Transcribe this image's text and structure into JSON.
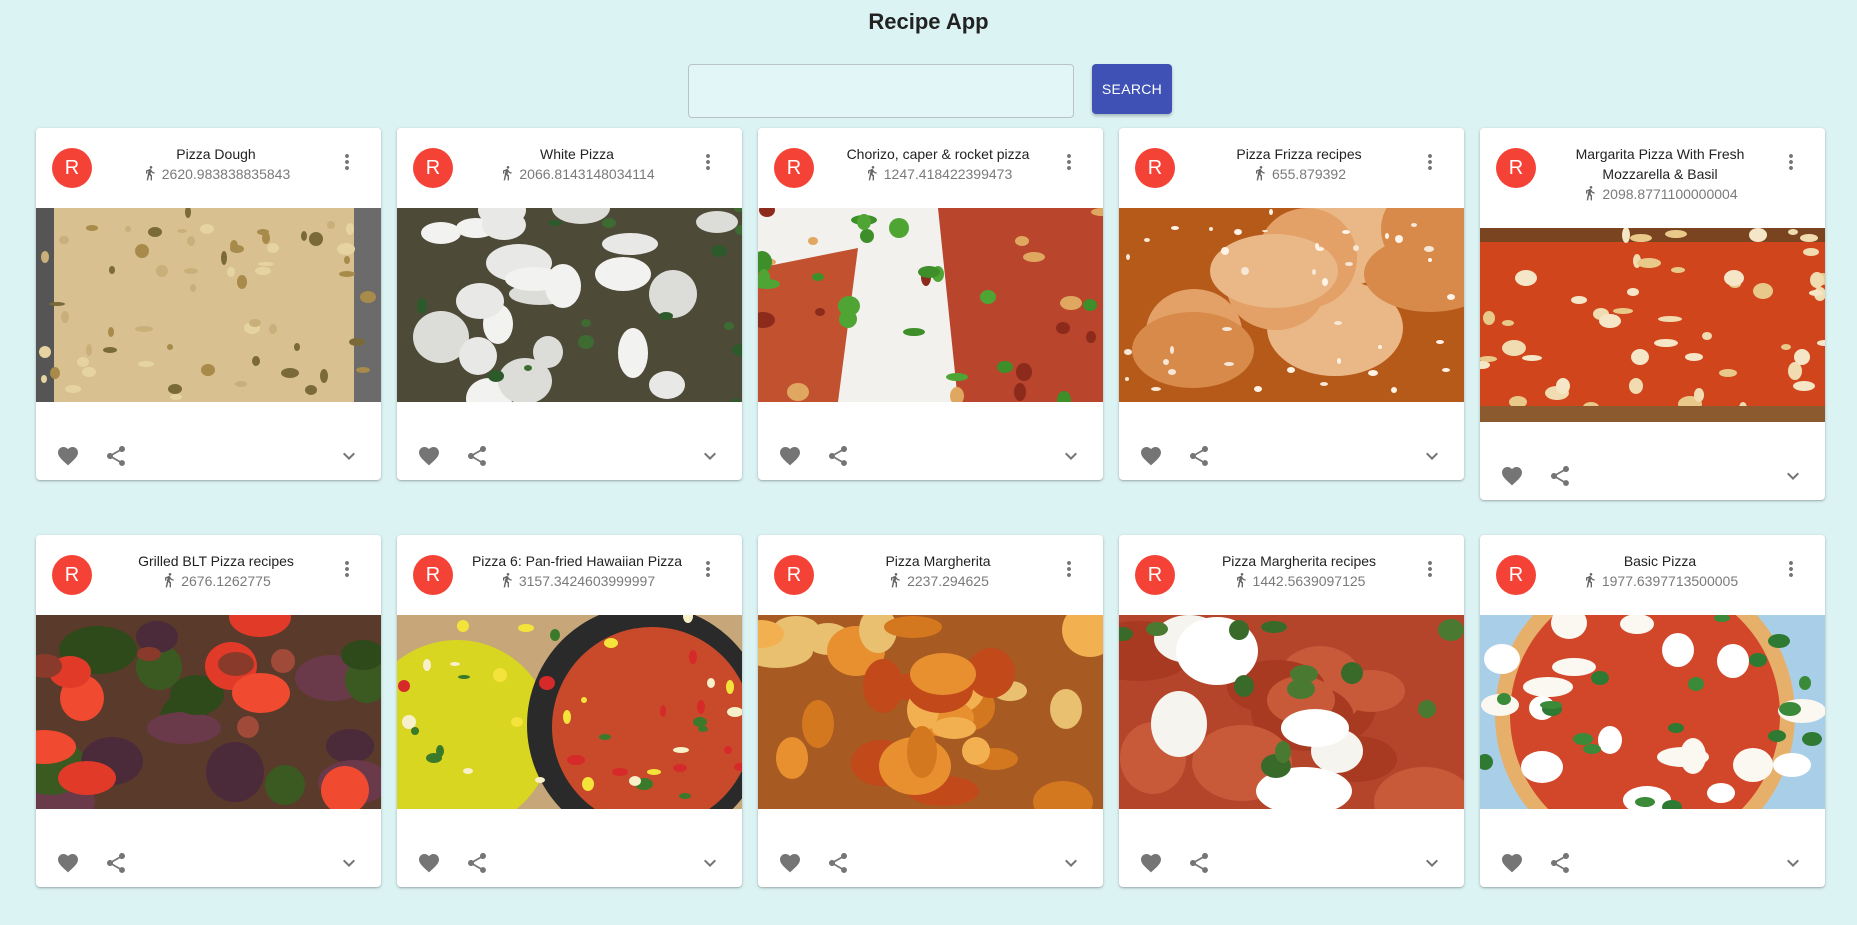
{
  "app": {
    "title": "Recipe App"
  },
  "search": {
    "value": "",
    "placeholder": "",
    "button_label": "SEARCH"
  },
  "recipes": [
    {
      "avatar": "R",
      "title": "Pizza Dough",
      "calories": "2620.983838835843",
      "image": "focaccia"
    },
    {
      "avatar": "R",
      "title": "White Pizza",
      "calories": "2066.8143148034114",
      "image": "white"
    },
    {
      "avatar": "R",
      "title": "Chorizo, caper & rocket pizza",
      "calories": "1247.418422399473",
      "image": "rocket"
    },
    {
      "avatar": "R",
      "title": "Pizza Frizza recipes",
      "calories": "655.879392",
      "image": "fritters"
    },
    {
      "avatar": "R",
      "title": "Margarita Pizza With Fresh Mozzarella & Basil",
      "calories": "2098.8771100000004",
      "image": "sheet"
    },
    {
      "avatar": "R",
      "title": "Grilled BLT Pizza recipes",
      "calories": "2676.1262775",
      "image": "blt"
    },
    {
      "avatar": "R",
      "title": "Pizza 6: Pan-fried Hawaiian Pizza",
      "calories": "3157.3424603999997",
      "image": "hawaiian"
    },
    {
      "avatar": "R",
      "title": "Pizza Margherita",
      "calories": "2237.294625",
      "image": "margherita1"
    },
    {
      "avatar": "R",
      "title": "Pizza Margherita recipes",
      "calories": "1442.5639097125",
      "image": "margherita2"
    },
    {
      "avatar": "R",
      "title": "Basic Pizza",
      "calories": "1977.6397713500005",
      "image": "basic"
    }
  ],
  "icons": {
    "calories": "run-icon",
    "menu": "more-vert-icon",
    "favorite": "heart-icon",
    "share": "share-icon",
    "expand": "chevron-down-icon"
  },
  "colors": {
    "avatar": "#f44336",
    "search_button": "#3f51b5",
    "background": "#dcf3f4"
  }
}
